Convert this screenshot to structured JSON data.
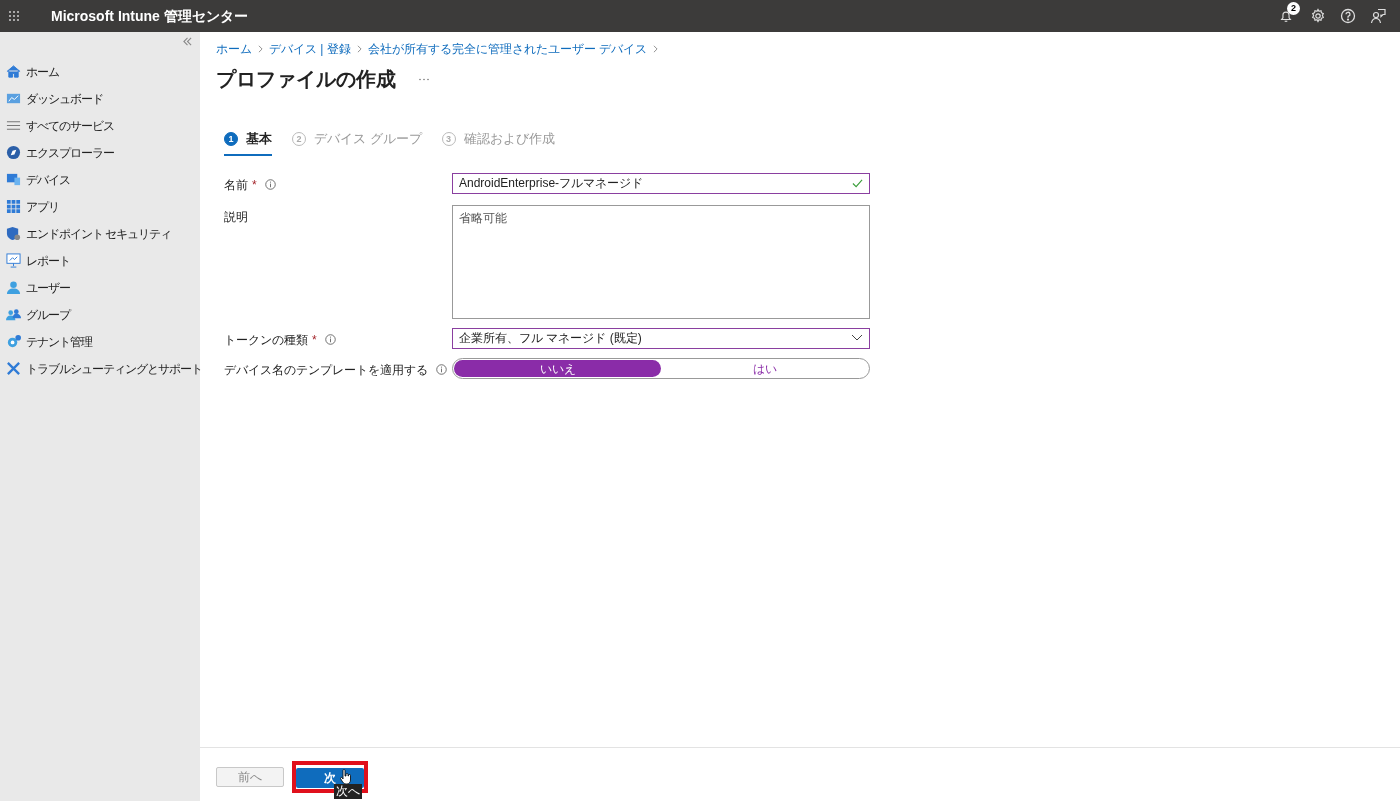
{
  "header": {
    "title": "Microsoft Intune 管理センター",
    "notification_count": "2"
  },
  "sidebar": {
    "items": [
      {
        "label": "ホーム"
      },
      {
        "label": "ダッシュボード"
      },
      {
        "label": "すべてのサービス"
      },
      {
        "label": "エクスプローラー"
      },
      {
        "label": "デバイス"
      },
      {
        "label": "アプリ"
      },
      {
        "label": "エンドポイント セキュリティ"
      },
      {
        "label": "レポート"
      },
      {
        "label": "ユーザー"
      },
      {
        "label": "グループ"
      },
      {
        "label": "テナント管理"
      },
      {
        "label": "トラブルシューティングとサポート"
      }
    ]
  },
  "breadcrumbs": [
    "ホーム",
    "デバイス | 登録",
    "会社が所有する完全に管理されたユーザー デバイス"
  ],
  "page_title": "プロファイルの作成",
  "steps": [
    {
      "number": "1",
      "label": "基本",
      "selected": true
    },
    {
      "number": "2",
      "label": "デバイス グループ",
      "selected": false
    },
    {
      "number": "3",
      "label": "確認および作成",
      "selected": false
    }
  ],
  "fields": [
    {
      "kind": "text",
      "label": "名前",
      "required_mark": "*",
      "value": "AndroidEnterprise-フルマネージド",
      "valid": true
    },
    {
      "kind": "textarea",
      "label": "説明",
      "placeholder": "省略可能"
    },
    {
      "kind": "dropdown",
      "label": "トークンの種類",
      "required_mark": "*",
      "value": "企業所有、フル マネージド (既定)"
    },
    {
      "kind": "toggle",
      "label": "デバイス名のテンプレートを適用する",
      "options": [
        {
          "label": "いいえ",
          "selected": true
        },
        {
          "label": "はい",
          "selected": false
        }
      ]
    }
  ],
  "footer": {
    "buttons": [
      {
        "label": "前へ",
        "disabled": true,
        "highlighted": false
      },
      {
        "label": "次",
        "disabled": false,
        "highlighted": true
      }
    ],
    "tooltip": "次へ"
  }
}
